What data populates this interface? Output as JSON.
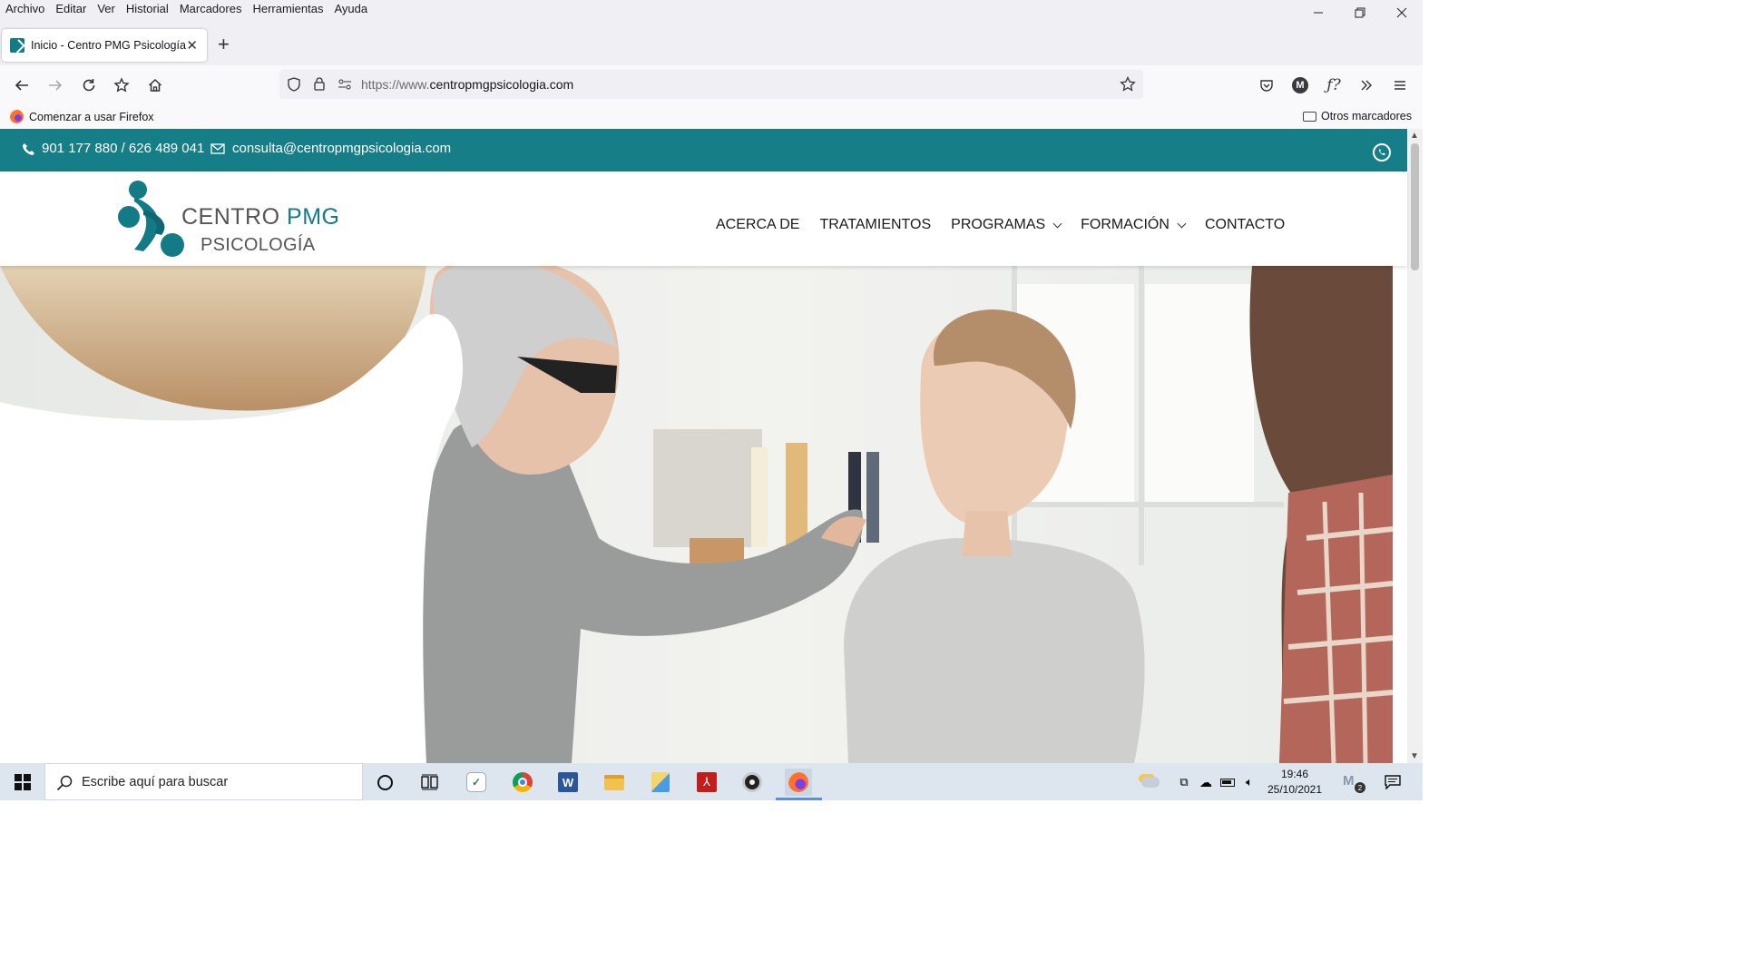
{
  "browser": {
    "menu": [
      "Archivo",
      "Editar",
      "Ver",
      "Historial",
      "Marcadores",
      "Herramientas",
      "Ayuda"
    ],
    "tab_title": "Inicio - Centro PMG Psicología",
    "url_prefix": "https://www.",
    "url_domain": "centropmgpsicologia.com",
    "bookmark_left": "Comenzar a usar Firefox",
    "bookmark_right": "Otros marcadores"
  },
  "site": {
    "phone": "901 177 880 / 626 489 041",
    "email": "consulta@centropmgpsicologia.com",
    "logo_line1_a": "CENTRO",
    "logo_line1_b": "PMG",
    "logo_line2": "PSICOLOGÍA",
    "nav": [
      "ACERCA DE",
      "TRATAMIENTOS",
      "PROGRAMAS",
      "FORMACIÓN",
      "CONTACTO"
    ],
    "brand_color": "#167e86"
  },
  "taskbar": {
    "search_placeholder": "Escribe aquí para buscar",
    "time": "19:46",
    "date": "25/10/2021",
    "notification_count": "2"
  }
}
